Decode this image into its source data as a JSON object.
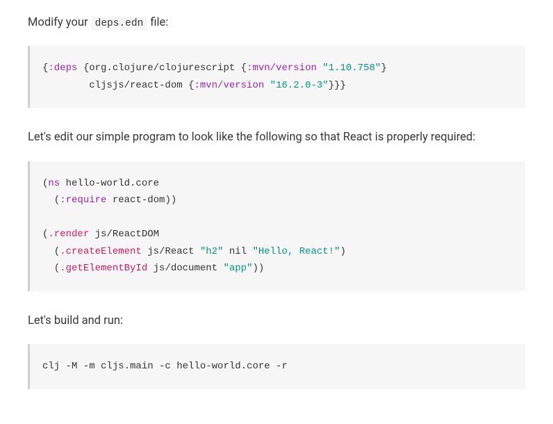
{
  "para1_pre": "Modify your ",
  "para1_code": "deps.edn",
  "para1_post": " file:",
  "code1": {
    "l1_open": "{",
    "l1_k1": ":deps",
    "l1_mid": " {org.clojure/clojurescript {",
    "l1_k2": ":mvn/version",
    "l1_sp": " ",
    "l1_s1": "\"1.10.758\"",
    "l1_close": "}",
    "l2_indent": "        cljsjs/react-dom {",
    "l2_k1": ":mvn/version",
    "l2_sp": " ",
    "l2_s1": "\"16.2.0-3\"",
    "l2_close": "}}}"
  },
  "para2": "Let's edit our simple program to look like the following so that React is properly required:",
  "code2": {
    "l1_open": "(",
    "l1_ns": "ns",
    "l1_rest": " hello-world.core",
    "l2_indent": "  (",
    "l2_req": ":require",
    "l2_rest": " react-dom))",
    "l3": "",
    "l4_open": "(",
    "l4_fn": ".render",
    "l4_rest": " js/ReactDOM",
    "l5_indent": "  (",
    "l5_fn": ".createElement",
    "l5_mid": " js/React ",
    "l5_s1": "\"h2\"",
    "l5_nil": " nil ",
    "l5_s2": "\"Hello, React!\"",
    "l5_close": ")",
    "l6_indent": "  (",
    "l6_fn": ".getElementById",
    "l6_mid": " js/document ",
    "l6_s1": "\"app\"",
    "l6_close": "))"
  },
  "para3": "Let's build and run:",
  "code3": {
    "l1": "clj -M -m cljs.main -c hello-world.core -r"
  }
}
